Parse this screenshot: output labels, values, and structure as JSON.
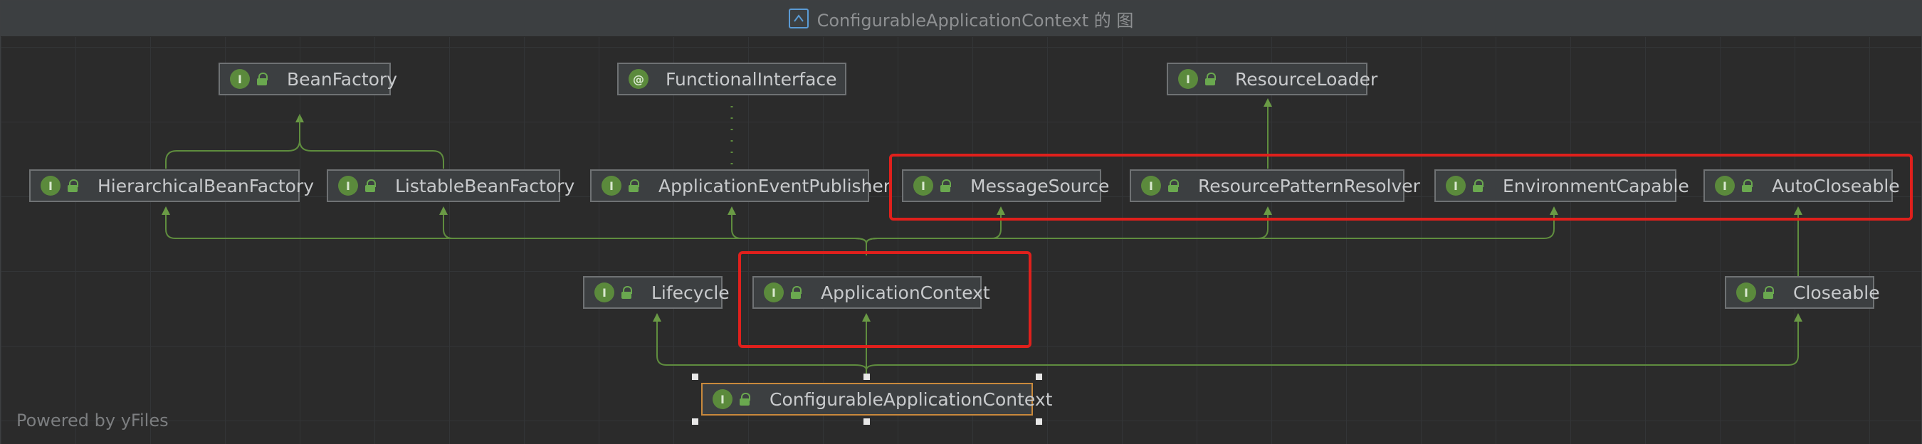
{
  "window": {
    "title": "ConfigurableApplicationContext 的 图",
    "title_icon": "class-diagram-icon"
  },
  "nodes": {
    "bean_factory": "BeanFactory",
    "functional_interface": "FunctionalInterface",
    "resource_loader": "ResourceLoader",
    "hierarchical_bean_factory": "HierarchicalBeanFactory",
    "listable_bean_factory": "ListableBeanFactory",
    "application_event_publisher": "ApplicationEventPublisher",
    "message_source": "MessageSource",
    "resource_pattern_resolver": "ResourcePatternResolver",
    "environment_capable": "EnvironmentCapable",
    "auto_closeable": "AutoCloseable",
    "lifecycle": "Lifecycle",
    "application_context": "ApplicationContext",
    "closeable": "Closeable",
    "configurable_application_context": "ConfigurableApplicationContext"
  },
  "badges": {
    "interface": "I",
    "annotation": "@"
  },
  "footer": {
    "text": "Powered by yFiles"
  },
  "colors": {
    "edge": "#5f8d3e",
    "highlight": "#e0201c",
    "selected_border": "#c9893c",
    "badge": "#5b8a3c"
  }
}
